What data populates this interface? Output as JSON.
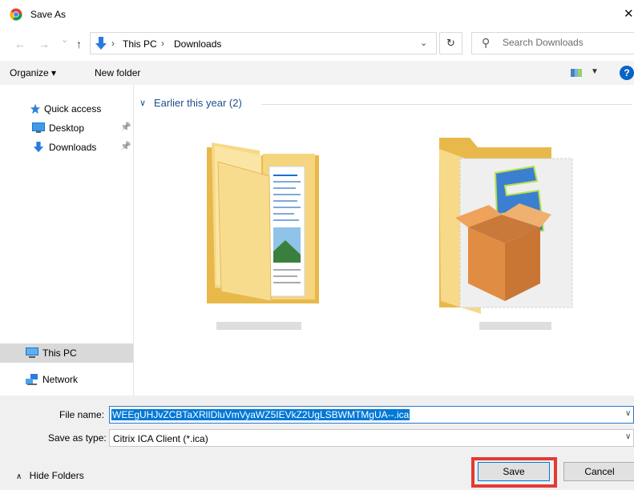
{
  "window": {
    "title": "Save As",
    "close_glyph": "✕",
    "app_icon": "chrome-icon"
  },
  "nav": {
    "back_glyph": "←",
    "forward_glyph": "→",
    "recent_glyph": "⌄",
    "up_glyph": "↑"
  },
  "address": {
    "crumbs": [
      "This PC",
      "Downloads"
    ],
    "separator": "›",
    "dropdown_glyph": "⌄",
    "refresh_glyph": "↻"
  },
  "search": {
    "placeholder": "Search Downloads"
  },
  "toolbar": {
    "organize_label": "Organize ▾",
    "new_folder_label": "New folder",
    "view_dropdown_glyph": "▼",
    "help_glyph": "?"
  },
  "sidebar": {
    "items": [
      {
        "label": "Quick access",
        "icon": "star-icon"
      },
      {
        "label": "Desktop",
        "icon": "desktop-icon",
        "pinned": true
      },
      {
        "label": "Downloads",
        "icon": "download-arrow-icon",
        "pinned": true
      },
      {
        "label": "This PC",
        "icon": "monitor-icon",
        "selected": true
      },
      {
        "label": "Network",
        "icon": "network-icon"
      }
    ],
    "pin_glyph": "📌"
  },
  "content": {
    "group_label": "Earlier this year (2)",
    "group_chevron": "∨",
    "files": [
      {
        "icon": "folder-with-documents-icon",
        "label": ""
      },
      {
        "icon": "folder-with-installer-package-icon",
        "label": ""
      }
    ]
  },
  "bottom": {
    "file_name_label": "File name:",
    "file_name_value": "WEEgUHJvZCBTaXRlIDluVmVyaWZ5IEVkZ2UgLSBWMTMgUA--.ica",
    "save_as_type_label": "Save as type:",
    "save_as_type_value": "Citrix ICA Client (*.ica)",
    "dropdown_glyph": "∨",
    "hide_folders_label": "Hide Folders",
    "hide_folders_chevron": "∧",
    "save_label": "Save",
    "cancel_label": "Cancel"
  },
  "colors": {
    "accent": "#0078d7",
    "highlight_box": "#e53935",
    "group_header": "#1e4e8c",
    "toolbar_bg": "#f3f3f3",
    "bottom_bg": "#f0f0f0"
  }
}
